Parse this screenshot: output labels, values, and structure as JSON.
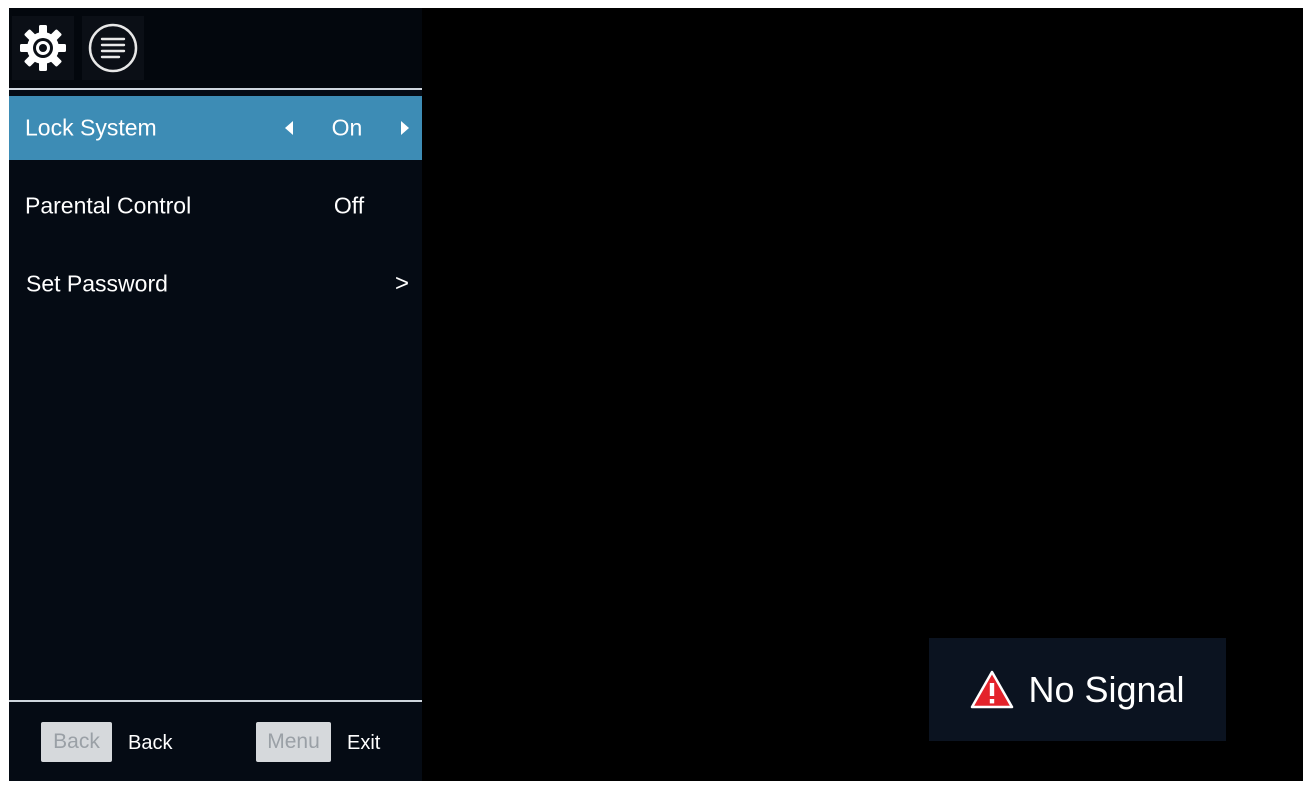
{
  "colors": {
    "highlight": "#3d8cb5",
    "panel_bg": "#050b14",
    "warning_red": "#e4232b"
  },
  "header": {
    "icons": [
      "gear-icon",
      "menu-list-icon"
    ]
  },
  "menu": {
    "items": [
      {
        "label": "Lock System",
        "value": "On",
        "selected": true,
        "control": "left-right-arrows"
      },
      {
        "label": "Parental Control",
        "value": "Off",
        "selected": false,
        "control": "none"
      },
      {
        "label": "Set Password",
        "value": "",
        "selected": false,
        "control": "chevron-right"
      }
    ]
  },
  "footer": {
    "back_key": "Back",
    "back_action": "Back",
    "menu_key": "Menu",
    "menu_action": "Exit"
  },
  "status": {
    "icon": "warning-icon",
    "text": "No Signal"
  }
}
